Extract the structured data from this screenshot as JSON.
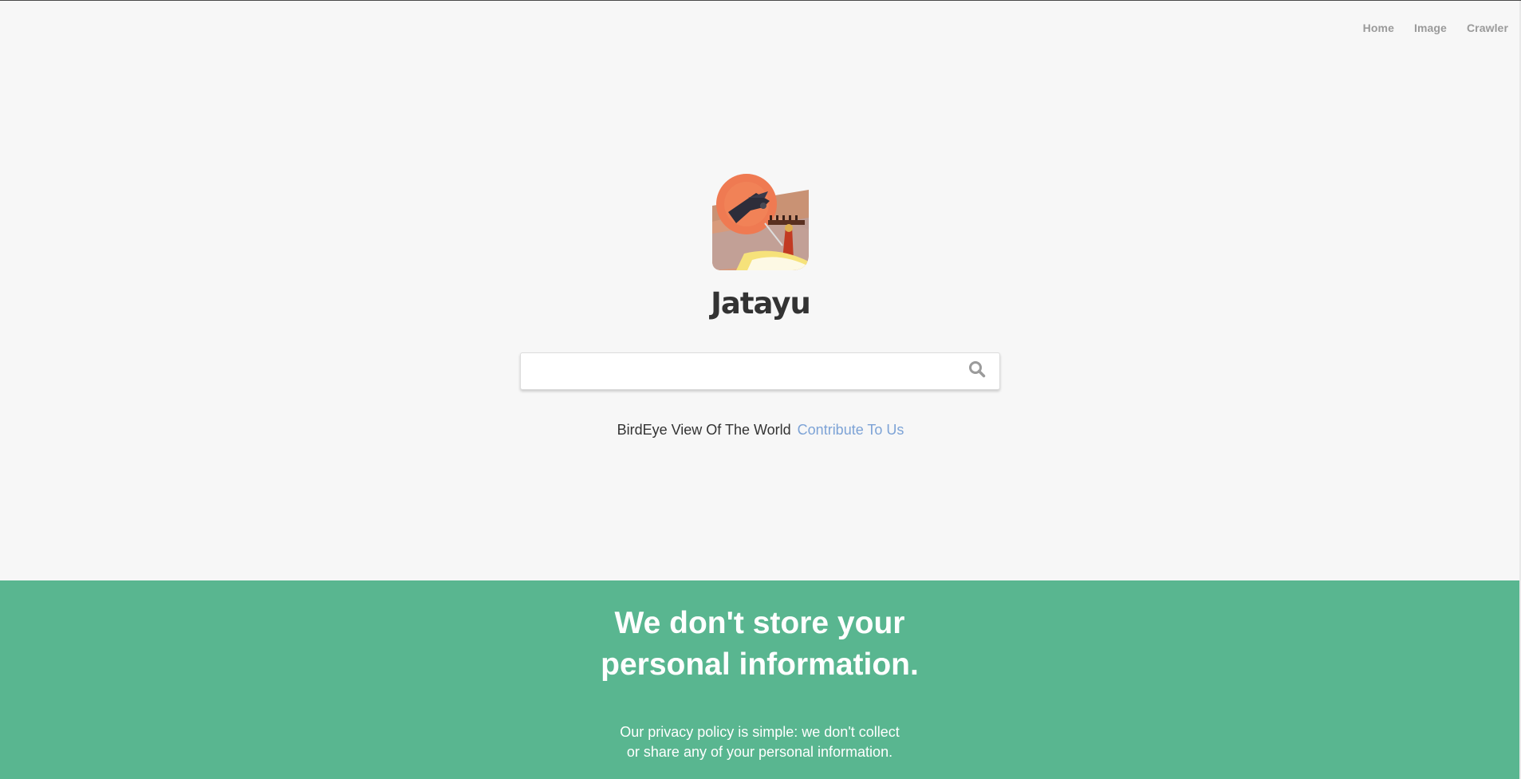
{
  "nav": {
    "items": [
      {
        "label": "Home"
      },
      {
        "label": "Image"
      },
      {
        "label": "Crawler"
      }
    ]
  },
  "brand": {
    "name": "Jatayu",
    "logo_icon": "jatayu-bird-logo-icon"
  },
  "search": {
    "value": "",
    "placeholder": "",
    "icon": "search-icon"
  },
  "tagline": {
    "text": "BirdEye View Of The World",
    "link_label": "Contribute To Us"
  },
  "privacy": {
    "title_line1": "We don't store your",
    "title_line2": "personal information.",
    "text_line1": "Our privacy policy is simple: we don't collect",
    "text_line2": "or share any of your personal information."
  },
  "colors": {
    "background": "#f7f7f7",
    "privacy_band": "#59b690",
    "link": "#7da3d6",
    "nav_text": "#9a9a9a"
  }
}
